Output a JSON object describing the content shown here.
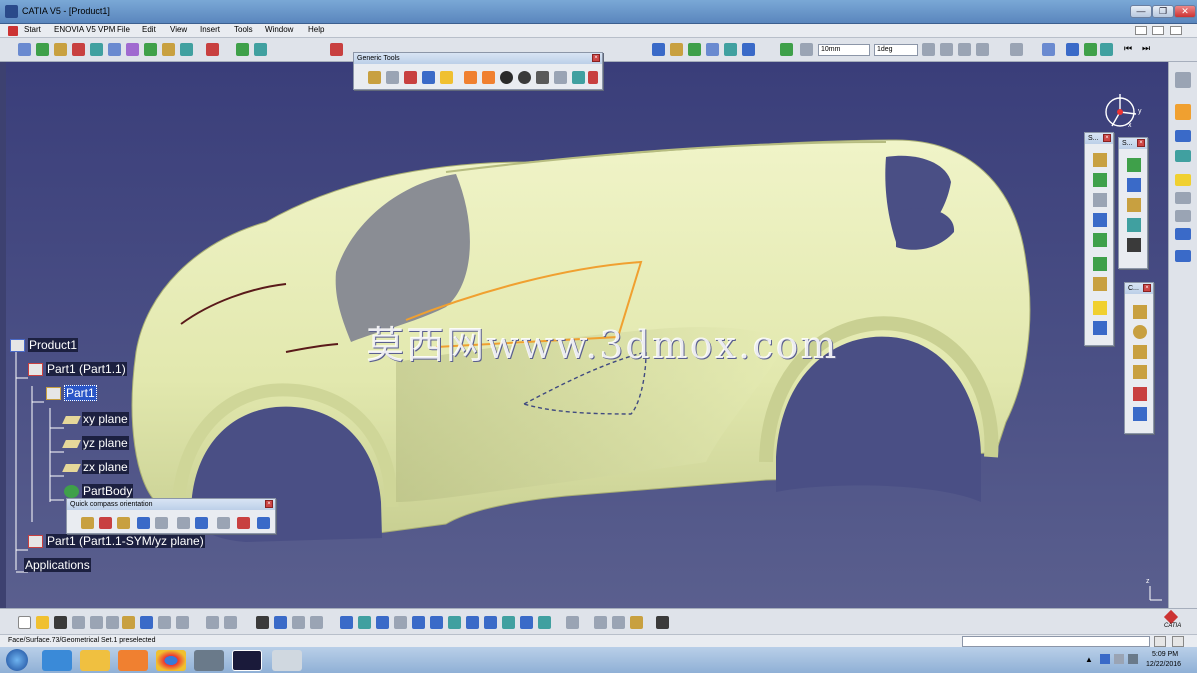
{
  "window": {
    "title": "CATIA V5 - [Product1]",
    "controls": {
      "minimize": "—",
      "restore": "❐",
      "close": "✕"
    }
  },
  "menubar": {
    "items": [
      "Start",
      "ENOVIA V5 VPM",
      "File",
      "Edit",
      "View",
      "Insert",
      "Tools",
      "Window",
      "Help"
    ]
  },
  "toolbar": {
    "length_field": "10mm",
    "angle_field": "1deg"
  },
  "generic_tools": {
    "title": "Generic Tools"
  },
  "quick_compass": {
    "title": "Quick compass orientation"
  },
  "side_panels": {
    "s1": "S...",
    "s2": "S...",
    "c1": "C..."
  },
  "tree": {
    "root": "Product1",
    "part1": "Part1 (Part1.1)",
    "part1_body": "Part1",
    "xy": "xy plane",
    "yz": "yz plane",
    "zx": "zx plane",
    "partbody": "PartBody",
    "part1sym": "Part1 (Part1.1-SYM/yz plane)",
    "applications": "Applications"
  },
  "watermark": "莫西网www.3dmox.com",
  "compass_axes": {
    "x": "x",
    "y": "y",
    "z": "z"
  },
  "status": {
    "message": "Face/Surface.73/Geometrical Set.1 preselected"
  },
  "logo": {
    "catia": "CATIA",
    "ds": "3DS"
  },
  "taskbar": {
    "time": "5:09 PM",
    "date": "12/22/2016"
  },
  "colors": {
    "viewport": "#454a80",
    "car_body": "#e6ecb4",
    "highlight_edge": "#f0a030",
    "selection": "#2a56c7"
  }
}
